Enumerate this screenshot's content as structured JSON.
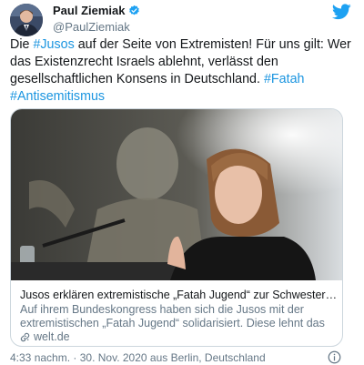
{
  "author": {
    "name": "Paul Ziemiak",
    "handle": "@PaulZiemiak",
    "verified_color": "#1da1f2"
  },
  "tweet": {
    "lines": [
      [
        {
          "t": "Die ",
          "tag": false
        },
        {
          "t": "#Jusos",
          "tag": true
        },
        {
          "t": " auf der Seite von Extremisten! Für uns gilt: Wer",
          "tag": false
        }
      ],
      [
        {
          "t": "das Existenzrecht Israels ablehnt, verlässt den",
          "tag": false
        }
      ],
      [
        {
          "t": "gesellschaftlichen Konsens in Deutschland. ",
          "tag": false
        },
        {
          "t": "#Fatah",
          "tag": true
        }
      ],
      [
        {
          "t": "#Antisemitismus",
          "tag": true
        }
      ]
    ],
    "hashtag_color": "#1b95e0"
  },
  "card": {
    "title": "Jusos erklären extremistische „Fatah Jugend“ zur Schwesterorganisat...",
    "description_line1": "Auf ihrem Bundeskongress haben sich die Jusos mit der",
    "description_line2": "extremistischen „Fatah Jugend“ solidarisiert. Diese lehnt das ...",
    "domain": "welt.de"
  },
  "meta": {
    "time": "4:33 nachm.",
    "separator": "·",
    "date": "30. Nov. 2020",
    "location_text": "aus Berlin, Deutschland"
  },
  "icons": {
    "verified": "verified-badge-icon",
    "twitter": "twitter-bird-icon",
    "link": "link-icon",
    "info": "info-icon"
  }
}
